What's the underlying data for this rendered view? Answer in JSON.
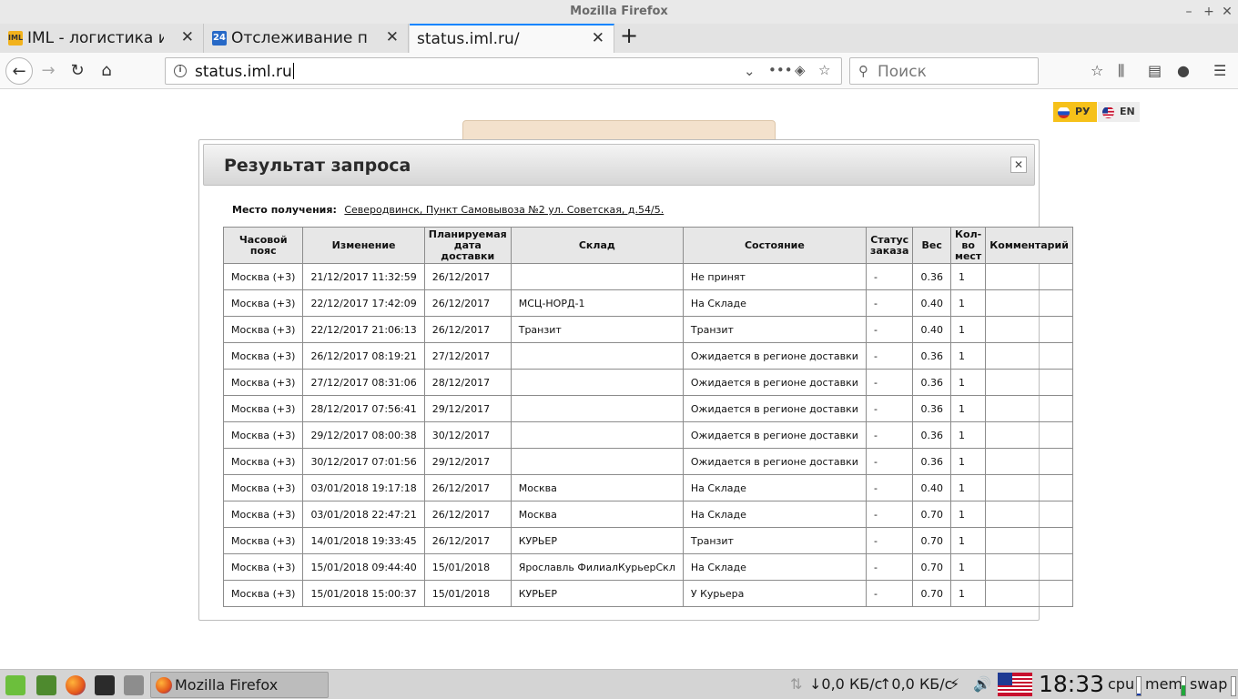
{
  "window": {
    "title": "Mozilla Firefox"
  },
  "tabs": [
    {
      "label": "IML - логистика интер",
      "favicon": "IML"
    },
    {
      "label": "Отслеживание почто",
      "favicon": "24"
    },
    {
      "label": "status.iml.ru/"
    }
  ],
  "toolbar": {
    "url": "status.iml.ru",
    "search_placeholder": "Поиск"
  },
  "lang": {
    "ru": "РУ",
    "en": "EN"
  },
  "modal": {
    "title": "Результат запроса",
    "place_label": "Место получения:",
    "place_value": "Северодвинск, Пункт Самовывоза №2 ул. Советская, д.54/5.",
    "columns": [
      "Часовой пояс",
      "Изменение",
      "Планируемая дата доставки",
      "Склад",
      "Состояние",
      "Статус заказа",
      "Вес",
      "Кол-во мест",
      "Комментарий"
    ],
    "rows": [
      [
        "Москва (+3)",
        "21/12/2017 11:32:59",
        "26/12/2017",
        "",
        "Не принят",
        "-",
        "0.36",
        "1",
        ""
      ],
      [
        "Москва (+3)",
        "22/12/2017 17:42:09",
        "26/12/2017",
        "МСЦ-НОРД-1",
        "На Складе",
        "-",
        "0.40",
        "1",
        ""
      ],
      [
        "Москва (+3)",
        "22/12/2017 21:06:13",
        "26/12/2017",
        "Транзит",
        "Транзит",
        "-",
        "0.40",
        "1",
        ""
      ],
      [
        "Москва (+3)",
        "26/12/2017 08:19:21",
        "27/12/2017",
        "",
        "Ожидается в регионе доставки",
        "-",
        "0.36",
        "1",
        ""
      ],
      [
        "Москва (+3)",
        "27/12/2017 08:31:06",
        "28/12/2017",
        "",
        "Ожидается в регионе доставки",
        "-",
        "0.36",
        "1",
        ""
      ],
      [
        "Москва (+3)",
        "28/12/2017 07:56:41",
        "29/12/2017",
        "",
        "Ожидается в регионе доставки",
        "-",
        "0.36",
        "1",
        ""
      ],
      [
        "Москва (+3)",
        "29/12/2017 08:00:38",
        "30/12/2017",
        "",
        "Ожидается в регионе доставки",
        "-",
        "0.36",
        "1",
        ""
      ],
      [
        "Москва (+3)",
        "30/12/2017 07:01:56",
        "29/12/2017",
        "",
        "Ожидается в регионе доставки",
        "-",
        "0.36",
        "1",
        ""
      ],
      [
        "Москва (+3)",
        "03/01/2018 19:17:18",
        "26/12/2017",
        "Москва",
        "На Складе",
        "-",
        "0.40",
        "1",
        ""
      ],
      [
        "Москва (+3)",
        "03/01/2018 22:47:21",
        "26/12/2017",
        "Москва",
        "На Складе",
        "-",
        "0.70",
        "1",
        ""
      ],
      [
        "Москва (+3)",
        "14/01/2018 19:33:45",
        "26/12/2017",
        "КУРЬЕР",
        "Транзит",
        "-",
        "0.70",
        "1",
        ""
      ],
      [
        "Москва (+3)",
        "15/01/2018 09:44:40",
        "15/01/2018",
        "Ярославль ФилиалКурьерСкл",
        "На Складе",
        "-",
        "0.70",
        "1",
        ""
      ],
      [
        "Москва (+3)",
        "15/01/2018 15:00:37",
        "15/01/2018",
        "КУРЬЕР",
        "У Курьера",
        "-",
        "0.70",
        "1",
        ""
      ]
    ]
  },
  "taskbar": {
    "active_window": "Mozilla Firefox",
    "net_down": "↓0,0 КБ/с",
    "net_up": "↑0,0 КБ/с",
    "clock": "18:33",
    "cpu_label": "cpu",
    "mem_label": "mem",
    "swap_label": "swap"
  }
}
